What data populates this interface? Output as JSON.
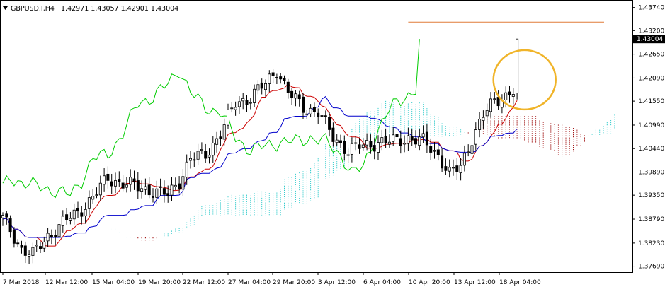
{
  "header": {
    "symbol_label": "GBPUSD.I,H4",
    "ohlc": "1.42971 1.43057 1.42901 1.43004"
  },
  "price_badge": "1.43004",
  "colors": {
    "candle": "#000000",
    "tenkan": "#cc0000",
    "kijun": "#0000cc",
    "chikou": "#00cc00",
    "cloud_bull": "#33cccc",
    "cloud_bear": "#990000",
    "resistance": "#e07b39",
    "highlight_circle": "#f0b429",
    "badge_bg": "#000000",
    "badge_text": "#ffffff"
  },
  "chart_data": {
    "type": "candlestick",
    "title": "GBPUSD.I,H4",
    "x_tick_labels": [
      "7 Mar 2018",
      "12 Mar 12:00",
      "15 Mar 04:00",
      "19 Mar 20:00",
      "22 Mar 12:00",
      "27 Mar 04:00",
      "29 Mar 20:00",
      "3 Apr 12:00",
      "6 Apr 04:00",
      "10 Apr 20:00",
      "13 Apr 12:00",
      "18 Apr 04:00"
    ],
    "y_ticks": [
      1.4374,
      1.432,
      1.4265,
      1.4209,
      1.4155,
      1.4099,
      1.4044,
      1.3989,
      1.3935,
      1.3879,
      1.3823,
      1.3769
    ],
    "ylim": [
      1.3755,
      1.439
    ],
    "candle_count": 138,
    "price_path": [
      [
        0,
        1.388
      ],
      [
        5,
        1.381
      ],
      [
        8,
        1.3795
      ],
      [
        12,
        1.384
      ],
      [
        16,
        1.387
      ],
      [
        20,
        1.3895
      ],
      [
        24,
        1.393
      ],
      [
        28,
        1.3975
      ],
      [
        33,
        1.396
      ],
      [
        38,
        1.395
      ],
      [
        44,
        1.3935
      ],
      [
        47,
        1.397
      ],
      [
        50,
        1.402
      ],
      [
        54,
        1.403
      ],
      [
        58,
        1.408
      ],
      [
        62,
        1.415
      ],
      [
        66,
        1.4165
      ],
      [
        70,
        1.4195
      ],
      [
        73,
        1.423
      ],
      [
        76,
        1.4175
      ],
      [
        80,
        1.414
      ],
      [
        84,
        1.413
      ],
      [
        88,
        1.407
      ],
      [
        92,
        1.404
      ],
      [
        96,
        1.405
      ],
      [
        100,
        1.406
      ],
      [
        104,
        1.406
      ],
      [
        108,
        1.407
      ],
      [
        112,
        1.406
      ],
      [
        116,
        1.403
      ],
      [
        119,
        1.3985
      ],
      [
        122,
        1.4
      ],
      [
        125,
        1.407
      ],
      [
        128,
        1.412
      ],
      [
        131,
        1.4155
      ],
      [
        134,
        1.417
      ],
      [
        137,
        1.4185
      ],
      [
        140,
        1.419
      ],
      [
        143,
        1.4205
      ],
      [
        146,
        1.4225
      ],
      [
        149,
        1.426
      ],
      [
        152,
        1.429
      ],
      [
        155,
        1.433
      ],
      [
        158,
        1.4355
      ],
      [
        160,
        1.4325
      ],
      [
        162,
        1.43
      ]
    ],
    "resistance_level": 1.434,
    "last_price": 1.43004
  }
}
